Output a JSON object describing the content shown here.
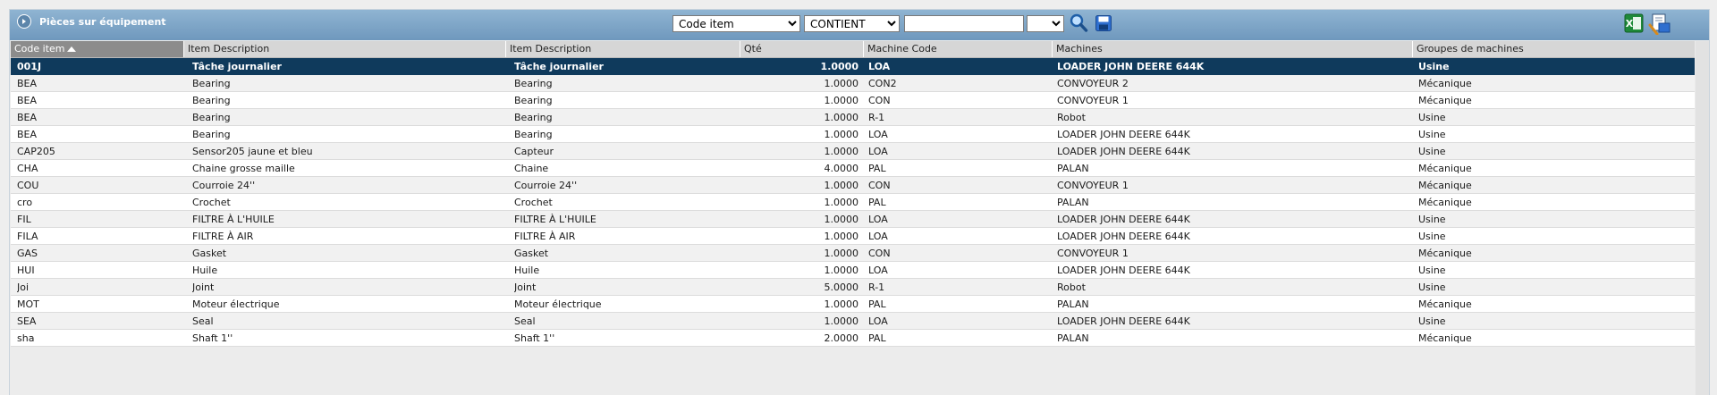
{
  "panel": {
    "title": "Pièces sur équipement"
  },
  "filters": {
    "field": {
      "selected": "Code item"
    },
    "operator": {
      "selected": "CONTIENT"
    },
    "value": "",
    "extra": {
      "selected": ""
    }
  },
  "colors": {
    "header_gradient_top": "#8fb4d2",
    "header_gradient_bottom": "#6f98bd",
    "selected_row": "#0f3a5c",
    "sorted_header": "#8c8c8c"
  },
  "icons": {
    "toggle": "collapse-arrow-icon",
    "search": "search-icon",
    "save": "save-icon",
    "excel": "excel-export-icon",
    "report": "report-icon"
  },
  "table": {
    "columns": [
      "Code item",
      "Item Description",
      "Item Description",
      "Qté",
      "Machine Code",
      "Machines",
      "Groupes de machines"
    ],
    "sorted_column": "Code item",
    "sort_direction": "ascending",
    "selected_row": 0,
    "rows": [
      [
        "001J",
        "Tâche journalier",
        "Tâche journalier",
        "1.0000",
        "LOA",
        "LOADER JOHN DEERE 644K",
        "Usine"
      ],
      [
        "BEA",
        "Bearing",
        "Bearing",
        "1.0000",
        "CON2",
        "CONVOYEUR 2",
        "Mécanique"
      ],
      [
        "BEA",
        "Bearing",
        "Bearing",
        "1.0000",
        "CON",
        "CONVOYEUR 1",
        "Mécanique"
      ],
      [
        "BEA",
        "Bearing",
        "Bearing",
        "1.0000",
        "R-1",
        "Robot",
        "Usine"
      ],
      [
        "BEA",
        "Bearing",
        "Bearing",
        "1.0000",
        "LOA",
        "LOADER JOHN DEERE 644K",
        "Usine"
      ],
      [
        "CAP205",
        "Sensor205 jaune et bleu",
        "Capteur",
        "1.0000",
        "LOA",
        "LOADER JOHN DEERE 644K",
        "Usine"
      ],
      [
        "CHA",
        "Chaine grosse maille",
        "Chaine",
        "4.0000",
        "PAL",
        "PALAN",
        "Mécanique"
      ],
      [
        "COU",
        "Courroie 24''",
        "Courroie 24''",
        "1.0000",
        "CON",
        "CONVOYEUR 1",
        "Mécanique"
      ],
      [
        "cro",
        "Crochet",
        "Crochet",
        "1.0000",
        "PAL",
        "PALAN",
        "Mécanique"
      ],
      [
        "FIL",
        "FILTRE À L'HUILE",
        "FILTRE À L'HUILE",
        "1.0000",
        "LOA",
        "LOADER JOHN DEERE 644K",
        "Usine"
      ],
      [
        "FILA",
        "FILTRE À AIR",
        "FILTRE À AIR",
        "1.0000",
        "LOA",
        "LOADER JOHN DEERE 644K",
        "Usine"
      ],
      [
        "GAS",
        "Gasket",
        "Gasket",
        "1.0000",
        "CON",
        "CONVOYEUR 1",
        "Mécanique"
      ],
      [
        "HUI",
        "Huile",
        "Huile",
        "1.0000",
        "LOA",
        "LOADER JOHN DEERE 644K",
        "Usine"
      ],
      [
        "Joi",
        "Joint",
        "Joint",
        "5.0000",
        "R-1",
        "Robot",
        "Usine"
      ],
      [
        "MOT",
        "Moteur électrique",
        "Moteur électrique",
        "1.0000",
        "PAL",
        "PALAN",
        "Mécanique"
      ],
      [
        "SEA",
        "Seal",
        "Seal",
        "1.0000",
        "LOA",
        "LOADER JOHN DEERE 644K",
        "Usine"
      ],
      [
        "sha",
        "Shaft 1''",
        "Shaft 1''",
        "2.0000",
        "PAL",
        "PALAN",
        "Mécanique"
      ]
    ]
  }
}
